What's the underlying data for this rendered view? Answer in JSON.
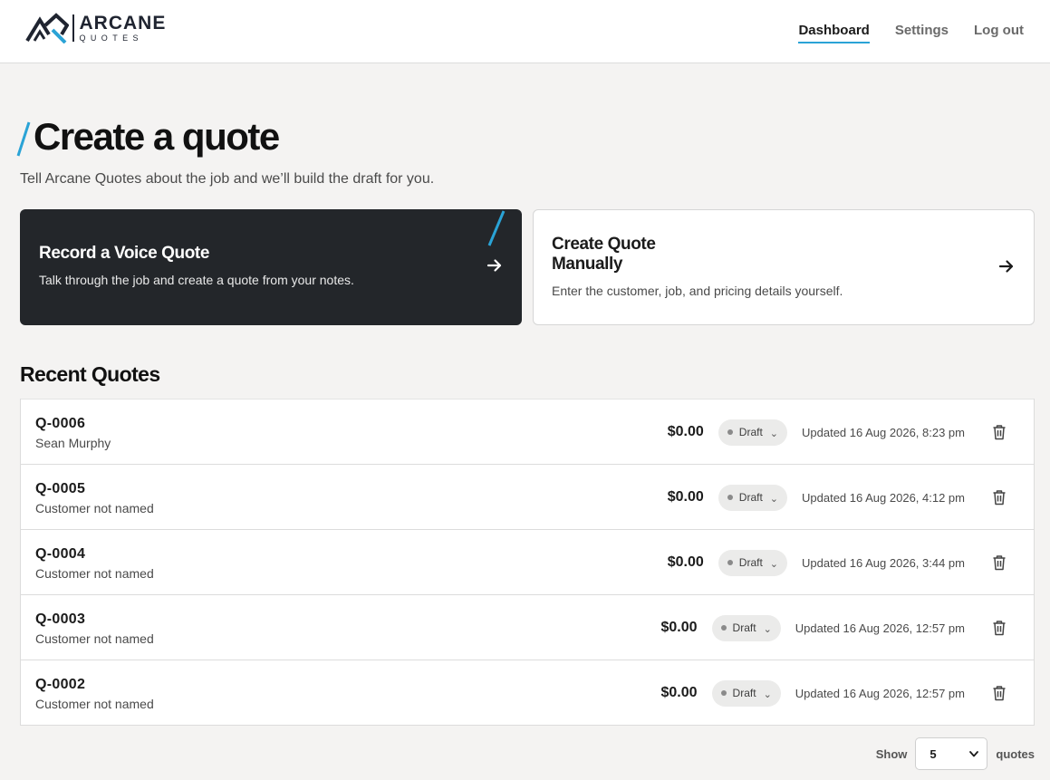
{
  "brand": {
    "name": "ARCANE",
    "sub": "QUOTES",
    "accent": "#2aa3d6"
  },
  "nav": [
    {
      "label": "Dashboard",
      "active": true
    },
    {
      "label": "Settings",
      "active": false
    },
    {
      "label": "Log out",
      "active": false
    }
  ],
  "page": {
    "title": "Create a quote",
    "subtitle": "Tell Arcane Quotes about the job and we’ll build the draft for you."
  },
  "cards": {
    "voice": {
      "title": "Record a Voice Quote",
      "desc": "Talk through the job and create a quote from your notes.",
      "icon": "arrow-right-icon"
    },
    "manual": {
      "title": "Create Quote Manually",
      "desc": "Enter the customer, job, and pricing details yourself.",
      "icon": "arrow-right-icon"
    }
  },
  "recent": {
    "title": "Recent Quotes",
    "quotes": [
      {
        "id": "Q-0006",
        "customer": "Sean Murphy",
        "amount": "$0.00",
        "status": "Draft",
        "updated": "Updated 16 Aug 2026, 8:23 pm"
      },
      {
        "id": "Q-0005",
        "customer": "Customer not named",
        "amount": "$0.00",
        "status": "Draft",
        "updated": "Updated 16 Aug 2026, 4:12 pm"
      },
      {
        "id": "Q-0004",
        "customer": "Customer not named",
        "amount": "$0.00",
        "status": "Draft",
        "updated": "Updated 16 Aug 2026, 3:44 pm"
      },
      {
        "id": "Q-0003",
        "customer": "Customer not named",
        "amount": "$0.00",
        "status": "Draft",
        "updated": "Updated 16 Aug 2026, 12:57 pm"
      },
      {
        "id": "Q-0002",
        "customer": "Customer not named",
        "amount": "$0.00",
        "status": "Draft",
        "updated": "Updated 16 Aug 2026, 12:57 pm"
      }
    ]
  },
  "pagination": {
    "show_label": "Show",
    "value": "5",
    "suffix": "quotes"
  }
}
